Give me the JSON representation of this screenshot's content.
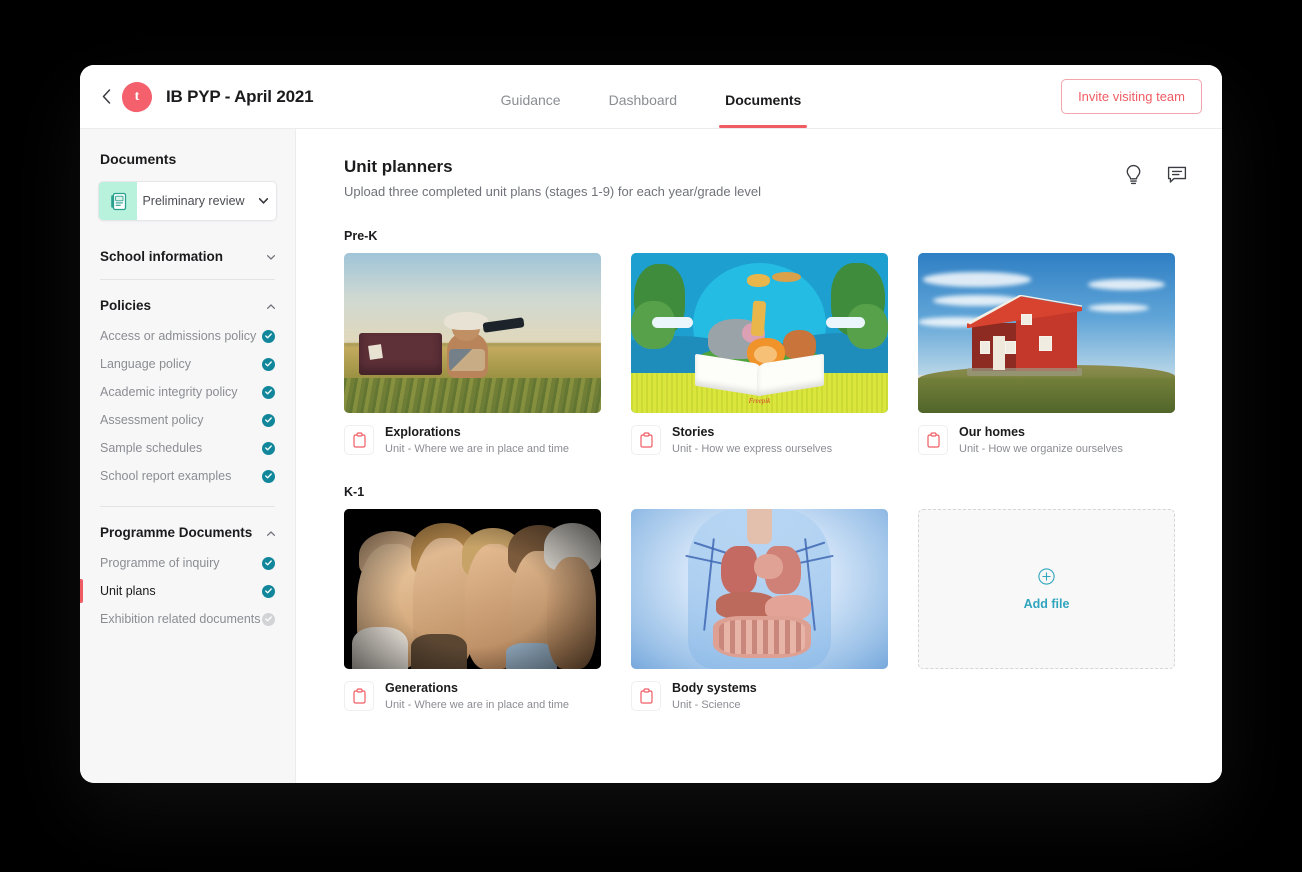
{
  "header": {
    "back_icon": "chevron-left-icon",
    "logo_letter": "t",
    "title": "IB PYP - April 2021",
    "tabs": [
      {
        "label": "Guidance",
        "active": false
      },
      {
        "label": "Dashboard",
        "active": false
      },
      {
        "label": "Documents",
        "active": true
      }
    ],
    "invite_button": "Invite visiting team",
    "accent_color": "#ef5c64"
  },
  "sidebar": {
    "title": "Documents",
    "review_select": {
      "icon": "notebook-icon",
      "value": "Preliminary review",
      "caret": "chevron-down-icon",
      "icon_bg": "#b8f2dd"
    },
    "sections": [
      {
        "label": "School information",
        "caret": "chevron-down-icon",
        "expanded": false,
        "items": []
      },
      {
        "label": "Policies",
        "caret": "chevron-up-icon",
        "expanded": true,
        "items": [
          {
            "label": "Access or admissions policy",
            "status": "complete",
            "active": false
          },
          {
            "label": "Language policy",
            "status": "complete",
            "active": false
          },
          {
            "label": "Academic integrity policy",
            "status": "complete",
            "active": false
          },
          {
            "label": "Assessment policy",
            "status": "complete",
            "active": false
          },
          {
            "label": "Sample schedules",
            "status": "complete",
            "active": false
          },
          {
            "label": "School report examples",
            "status": "complete",
            "active": false
          }
        ]
      },
      {
        "label": "Programme Documents",
        "caret": "chevron-up-icon",
        "expanded": true,
        "items": [
          {
            "label": "Programme of inquiry",
            "status": "complete",
            "active": false
          },
          {
            "label": "Unit plans",
            "status": "complete",
            "active": true
          },
          {
            "label": "Exhibition related documents",
            "status": "incomplete",
            "active": false
          }
        ]
      }
    ],
    "status_complete_color": "#12879b",
    "status_incomplete_color": "#d2d3d6"
  },
  "main": {
    "title": "Unit planners",
    "subtitle": "Upload three completed unit plans (stages 1-9) for each year/grade level",
    "header_icons": [
      {
        "name": "lightbulb-icon"
      },
      {
        "name": "comment-icon"
      }
    ],
    "groups": [
      {
        "grade": "Pre-K",
        "cards": [
          {
            "name": "Explorations",
            "unit": "Unit - Where we are in place and time",
            "image": "child-telescope-field",
            "file_icon": "document-icon"
          },
          {
            "name": "Stories",
            "unit": "Unit - How we express ourselves",
            "image": "animals-storybook",
            "file_icon": "document-icon"
          },
          {
            "name": "Our homes",
            "unit": "Unit - How we organize ourselves",
            "image": "red-house-hill",
            "file_icon": "document-icon"
          }
        ],
        "add_tile": null
      },
      {
        "grade": "K-1",
        "cards": [
          {
            "name": "Generations",
            "unit": "Unit - Where we are in place and time",
            "image": "five-generations-profiles",
            "file_icon": "document-icon"
          },
          {
            "name": "Body systems",
            "unit": "Unit - Science",
            "image": "human-anatomy-torso",
            "file_icon": "document-icon"
          }
        ],
        "add_tile": {
          "label": "Add file",
          "icon": "plus-circle-icon",
          "color": "#2fa5bd"
        }
      }
    ]
  }
}
